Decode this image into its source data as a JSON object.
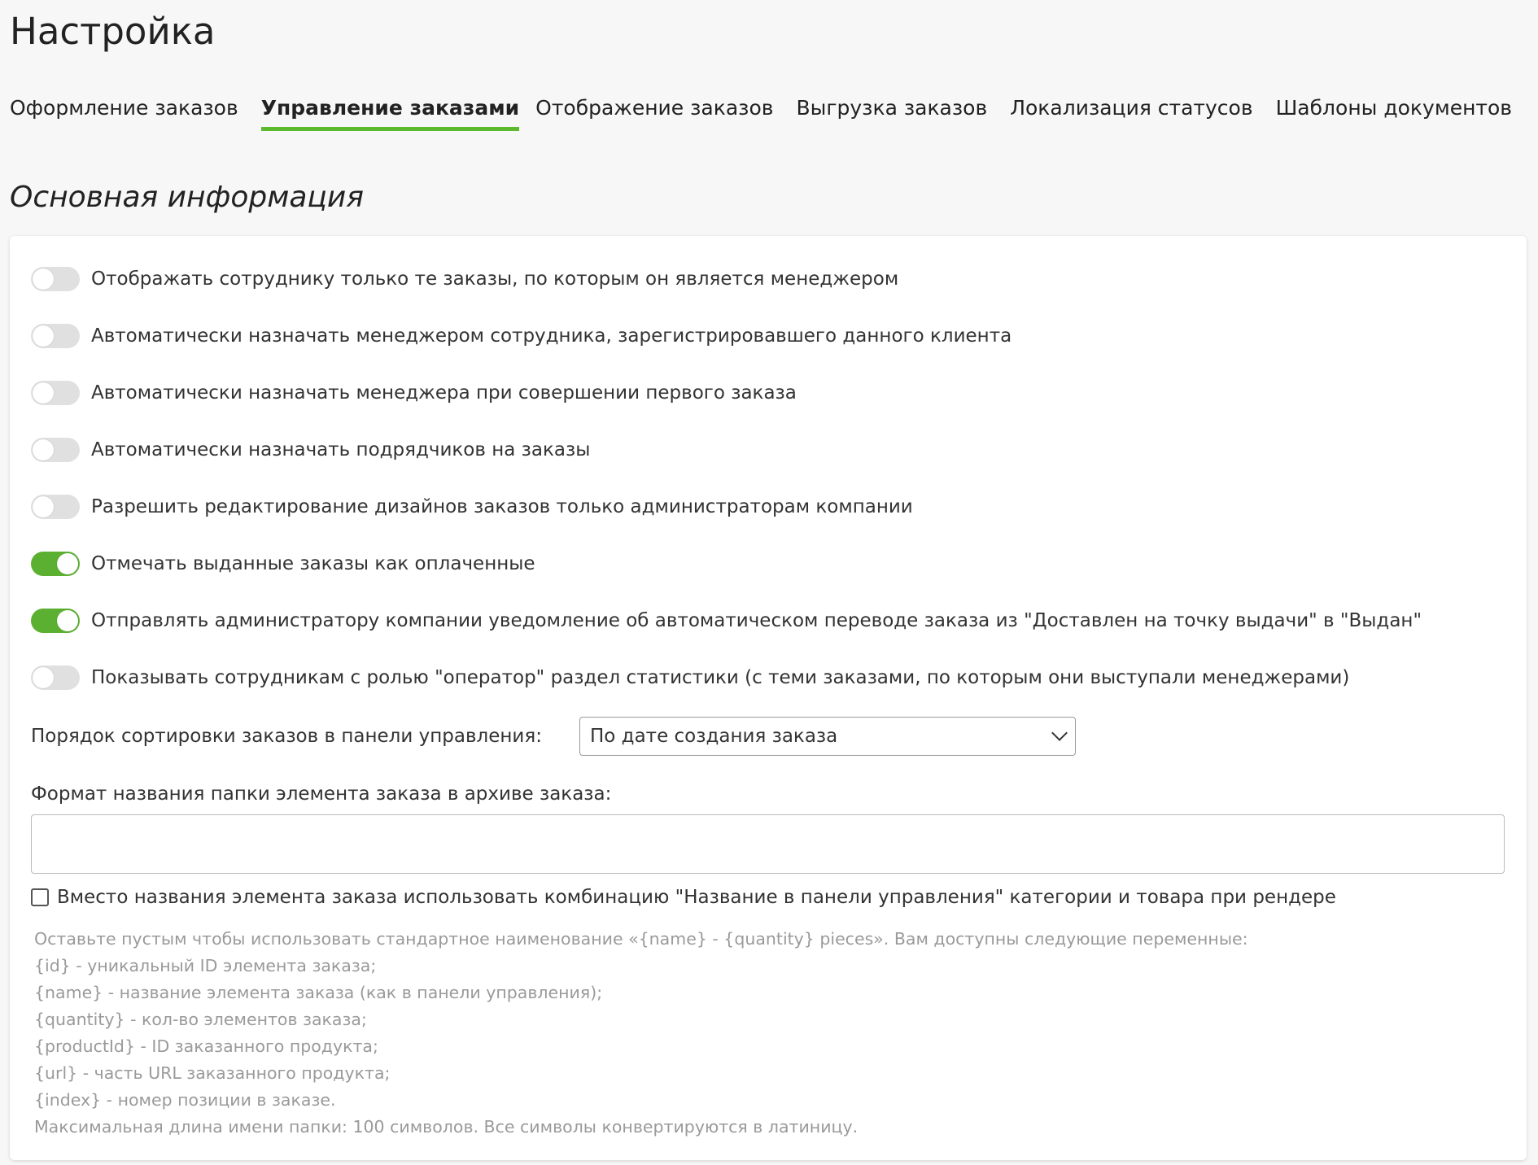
{
  "page": {
    "title": "Настройка"
  },
  "tabs": [
    {
      "label": "Оформление заказов",
      "active": false
    },
    {
      "label": "Управление заказами",
      "active": true
    },
    {
      "label": "Отображение заказов",
      "active": false
    },
    {
      "label": "Выгрузка заказов",
      "active": false
    },
    {
      "label": "Локализация статусов",
      "active": false
    },
    {
      "label": "Шаблоны документов",
      "active": false
    }
  ],
  "section": {
    "title": "Основная информация"
  },
  "toggles": [
    {
      "label": "Отображать сотруднику только те заказы, по которым он является менеджером",
      "on": false
    },
    {
      "label": "Автоматически назначать менеджером сотрудника, зарегистрировавшего данного клиента",
      "on": false
    },
    {
      "label": "Автоматически назначать менеджера при совершении первого заказа",
      "on": false
    },
    {
      "label": "Автоматически назначать подрядчиков на заказы",
      "on": false
    },
    {
      "label": "Разрешить редактирование дизайнов заказов только администраторам компании",
      "on": false
    },
    {
      "label": "Отмечать выданные заказы как оплаченные",
      "on": true
    },
    {
      "label": "Отправлять администратору компании уведомление об автоматическом переводе заказа из \"Доставлен на точку выдачи\" в \"Выдан\"",
      "on": true
    },
    {
      "label": "Показывать сотрудникам с ролью \"оператор\" раздел статистики (с теми заказами, по которым они выступали менеджерами)",
      "on": false
    }
  ],
  "sort": {
    "label": "Порядок сортировки заказов в панели управления:",
    "value": "По дате создания заказа"
  },
  "folder_format": {
    "label": "Формат названия папки элемента заказа в архиве заказа:",
    "value": "",
    "placeholder": ""
  },
  "checkbox": {
    "label": "Вместо названия элемента заказа использовать комбинацию \"Название в панели управления\" категории и товара при рендере",
    "checked": false
  },
  "help": [
    "Оставьте пустым чтобы использовать стандартное наименование «{name} - {quantity} pieces». Вам доступны следующие переменные:",
    "{id} - уникальный ID элемента заказа;",
    "{name} - название элемента заказа (как в панели управления);",
    "{quantity} - кол-во элементов заказа;",
    "{productId} - ID заказанного продукта;",
    "{url} - часть URL заказанного продукта;",
    "{index} - номер позиции в заказе.",
    "Максимальная длина имени папки: 100 символов. Все символы конвертируются в латиницу."
  ],
  "colors": {
    "accent": "#5cb82c",
    "toggle_on": "#5cb031",
    "toggle_off": "#e0e0e0"
  }
}
